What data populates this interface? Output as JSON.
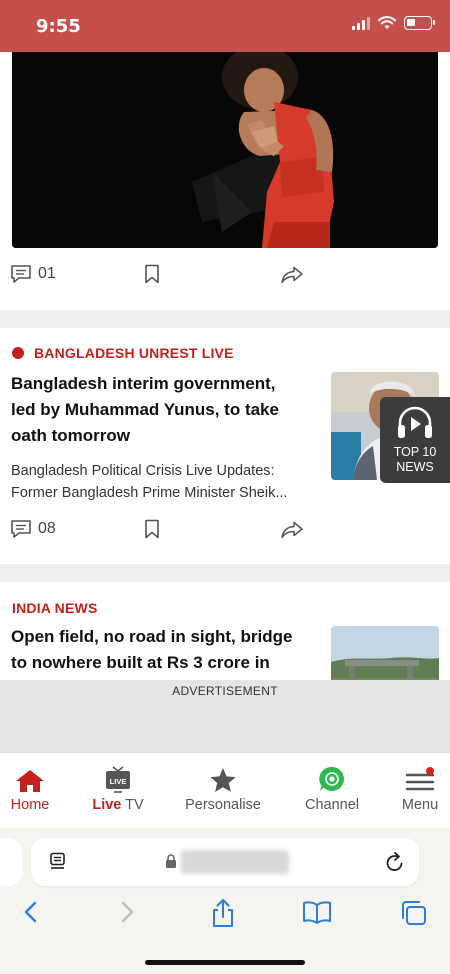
{
  "status_bar": {
    "time": "9:55"
  },
  "colors": {
    "brand_red": "#c4201c",
    "status_bar": "#c4504c"
  },
  "cards": [
    {
      "image_alt": "wrestler in red singlet with folded hands",
      "comments": "01"
    },
    {
      "tag": "BANGLADESH UNREST LIVE",
      "live_dot": true,
      "headline_lines": [
        "Bangladesh interim government,",
        "led by Muhammad Yunus, to take",
        "oath tomorrow"
      ],
      "summary_lines": [
        "Bangladesh Political Crisis Live Updates:",
        "Former Bangladesh Prime Minister Sheik..."
      ],
      "comments": "08"
    },
    {
      "tag": "INDIA NEWS",
      "headline_lines": [
        "Open field, no road in sight, bridge",
        "to nowhere built at Rs 3 crore in"
      ]
    }
  ],
  "top10": {
    "line1": "TOP 10",
    "line2": "NEWS",
    "icon": "headphones-play-icon"
  },
  "advertisement": {
    "label": "ADVERTISEMENT"
  },
  "bottom_nav": {
    "home": "Home",
    "live_prefix": "Live",
    "live_suffix": " TV",
    "live_badge": "LIVE",
    "personalise": "Personalise",
    "channel": "Channel",
    "menu": "Menu",
    "active": "home"
  },
  "safari": {
    "icons": [
      "reader-icon",
      "lock-icon",
      "reload-icon",
      "back-icon",
      "forward-icon",
      "share-icon",
      "bookmarks-icon",
      "tabs-icon"
    ]
  }
}
